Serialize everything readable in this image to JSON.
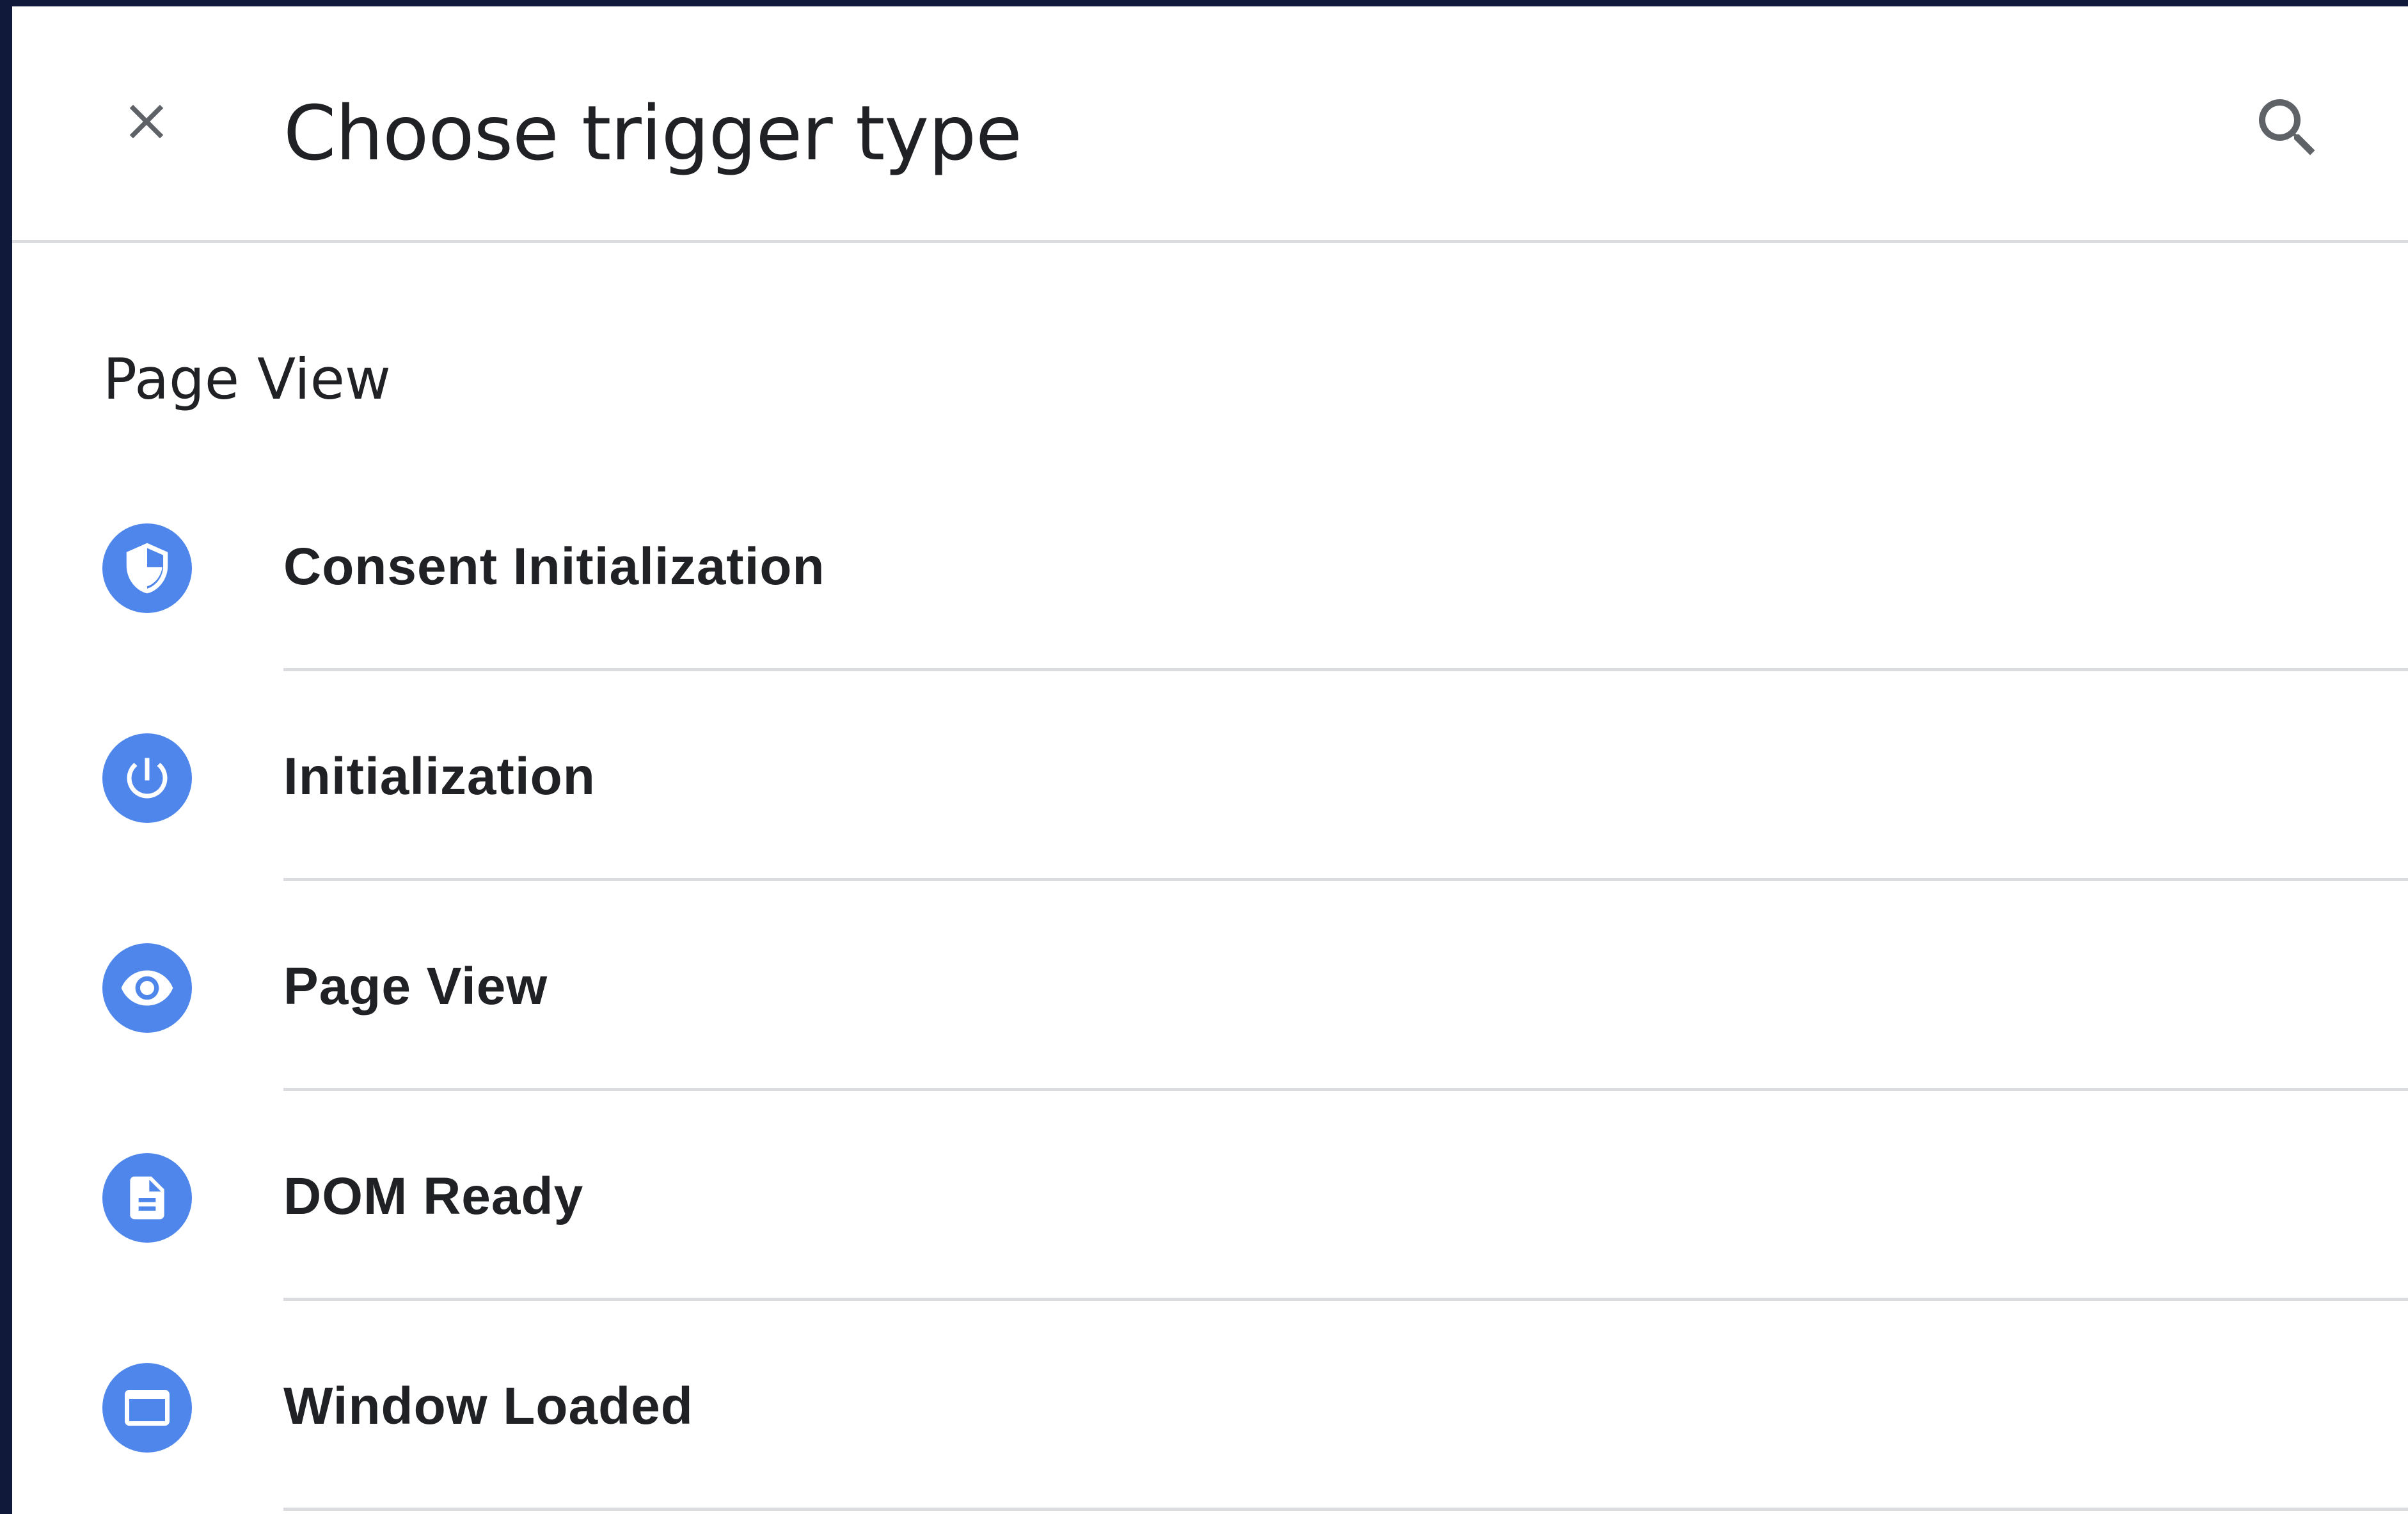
{
  "dialog": {
    "title": "Choose trigger type",
    "close_icon": "close-icon",
    "search_icon": "search-icon"
  },
  "section": {
    "heading": "Page View"
  },
  "colors": {
    "icon_background": "#4f86ec",
    "divider": "#dadce0",
    "frame": "#11193a",
    "text": "#202124"
  },
  "triggers": [
    {
      "label": "Consent Initialization",
      "icon": "shield-icon"
    },
    {
      "label": "Initialization",
      "icon": "power-icon"
    },
    {
      "label": "Page View",
      "icon": "eye-icon"
    },
    {
      "label": "DOM Ready",
      "icon": "document-icon"
    },
    {
      "label": "Window Loaded",
      "icon": "window-icon"
    }
  ]
}
